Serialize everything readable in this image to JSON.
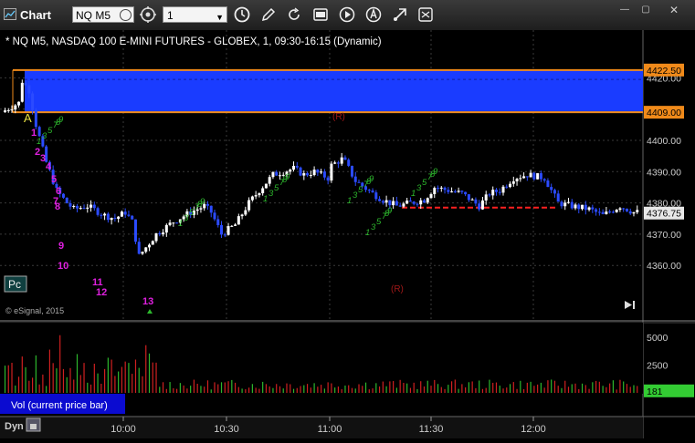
{
  "toolbar": {
    "title": "Chart",
    "symbol": "NQ M5",
    "interval": "1",
    "icons": [
      "search-icon",
      "link-icon",
      "clock-icon",
      "pencil-icon",
      "refresh-icon",
      "calendar-icon",
      "play-icon",
      "alert-icon",
      "cursor-icon",
      "text-icon",
      "minimize-icon",
      "maximize-icon",
      "close-icon"
    ]
  },
  "chart": {
    "header": "* NQ M5, NASDAQ 100 E-MINI FUTURES - GLOBEX, 1, 09:30-16:15 (Dynamic)",
    "price_axis": [
      "4420.00",
      "4410.00",
      "4400.00",
      "4390.00",
      "4380.00",
      "4370.00",
      "4360.00"
    ],
    "price_tags": {
      "high": "4422.50",
      "low": "4409.00",
      "last": "4376.75"
    },
    "time_axis": [
      "10:00",
      "10:30",
      "11:00",
      "11:30",
      "12:00"
    ],
    "copyright": "© eSignal, 2015",
    "pc_label": "Pc",
    "a_label": "A",
    "r_labels": [
      "(R)",
      "(R)"
    ],
    "magenta_counts": [
      "1",
      "2",
      "3",
      "4",
      "5",
      "6",
      "7",
      "8",
      "9",
      "10",
      "11",
      "12",
      "13"
    ],
    "green_counts": [
      "1",
      "2",
      "3",
      "4",
      "5",
      "6",
      "7",
      "8",
      "9"
    ],
    "volume_axis": [
      "5000",
      "2500"
    ],
    "volume_last": "181",
    "volume_label": "Vol (current price bar)",
    "dyn_label": "Dyn",
    "colors": {
      "up": "#ffffff",
      "down": "#2b4bff",
      "zone": "#1a3cff",
      "orange": "#f08a1a",
      "magenta": "#e020e0",
      "green": "#2db82d",
      "red": "#ff2020",
      "volume_tag": "#33cc33"
    }
  },
  "chart_data": {
    "type": "candlestick",
    "title": "NQ M5, NASDAQ 100 E-MINI FUTURES - GLOBEX, 1, 09:30-16:15 (Dynamic)",
    "x_ticks": [
      "10:00",
      "10:30",
      "11:00",
      "11:30",
      "12:00"
    ],
    "y_ticks": [
      4420,
      4410,
      4400,
      4390,
      4380,
      4370,
      4360
    ],
    "ylim": [
      4357,
      4427
    ],
    "zone": [
      4409.0,
      4422.5
    ],
    "dashed_level": 4378.5,
    "last_price": 4376.75,
    "trace_x": [
      0,
      5,
      6,
      8,
      10,
      13,
      16,
      19,
      21,
      25,
      30,
      33,
      36,
      38,
      40,
      45,
      50,
      55,
      59,
      61,
      64,
      68,
      72,
      75,
      79,
      85,
      88,
      91,
      95,
      96,
      99,
      100,
      103,
      108,
      111,
      115,
      119,
      123,
      126,
      130,
      134,
      139,
      142,
      145,
      149,
      153,
      158,
      162,
      166,
      171,
      175,
      180,
      184
    ],
    "trace_y": [
      4409,
      4412,
      4419,
      4416,
      4405,
      4393,
      4384,
      4380,
      4378,
      4379,
      4376,
      4375,
      4377,
      4374,
      4363,
      4370,
      4374,
      4377,
      4379,
      4377,
      4370,
      4373,
      4380,
      4384,
      4389,
      4391,
      4389,
      4390,
      4388,
      4392,
      4394,
      4393,
      4387,
      4383,
      4381,
      4379,
      4380,
      4381,
      4385,
      4384,
      4383,
      4379,
      4383,
      4384,
      4388,
      4389,
      4388,
      4380,
      4379,
      4378,
      4376,
      4379,
      4377
    ],
    "volume_ylim": [
      0,
      6000
    ],
    "volume_y_ticks": [
      5000,
      2500
    ],
    "volume_last": 181
  }
}
